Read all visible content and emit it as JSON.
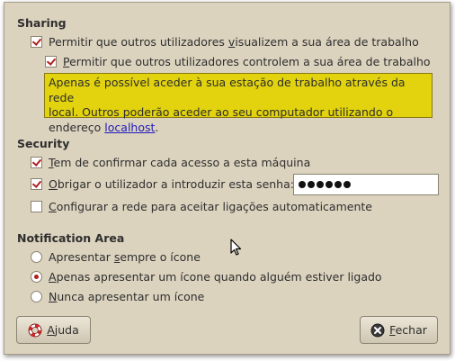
{
  "sharing": {
    "heading": "Sharing",
    "allow_view": {
      "pre": "Permitir que outros utilizadores ",
      "key": "v",
      "post": "isualizem a sua área de trabalho",
      "checked": true
    },
    "allow_control": {
      "pre": "",
      "key": "P",
      "post": "ermitir que outros utilizadores controlem a sua área de trabalho",
      "checked": true
    },
    "info": {
      "line1": "Apenas é possível aceder à sua estação de trabalho através da rede",
      "line2": "local. Outros poderão aceder ao seu computador utilizando o",
      "line3_pre": "endereço ",
      "link": "localhost",
      "line3_post": "."
    }
  },
  "security": {
    "heading": "Security",
    "confirm": {
      "pre": "",
      "key": "T",
      "post": "em de confirmar cada acesso a esta máquina",
      "checked": true
    },
    "require_password": {
      "pre": "",
      "key": "O",
      "post": "brigar o utilizador a introduzir esta senha:",
      "checked": true
    },
    "password_length": 6,
    "configure_network": {
      "pre": "",
      "key": "C",
      "post": "onfigurar a rede para aceitar ligações automaticamente",
      "checked": false
    }
  },
  "notification": {
    "heading": "Notification Area",
    "options": [
      {
        "pre": "Apresentar ",
        "key": "s",
        "post": "empre o ícone",
        "selected": false
      },
      {
        "pre": "",
        "key": "A",
        "post": "penas apresentar um ícone quando alguém estiver ligado",
        "selected": true
      },
      {
        "pre": "",
        "key": "N",
        "post": "unca apresentar um ícone",
        "selected": false
      }
    ]
  },
  "buttons": {
    "help": {
      "key": "A",
      "post": "juda",
      "icon": "lifebuoy-icon"
    },
    "close": {
      "key": "F",
      "post": "echar",
      "icon": "close-icon"
    }
  },
  "colors": {
    "window_bg": "#dcd3bf",
    "info_bg": "#e2d30e",
    "check_mark": "#b01e1e",
    "link": "#1f1bb8"
  }
}
